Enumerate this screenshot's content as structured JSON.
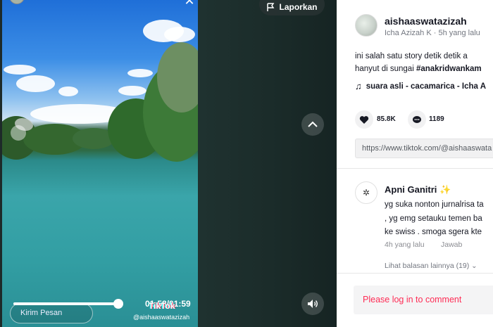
{
  "player": {
    "report_label": "Laporkan",
    "time_text": "01:58/01:59",
    "progress_fraction": 0.99,
    "send_message_placeholder": "Kirim Pesan",
    "watermark_logo": "TikTok",
    "watermark_user": "@aishaaswatazizah"
  },
  "post": {
    "username": "aishaaswatazizah",
    "display_name": "Icha Azizah K",
    "time_ago": "5h yang lalu",
    "caption_line1": "ini salah satu story detik detik a",
    "caption_line2_pre": "hanyut di sungai ",
    "caption_hashtag": "#anakridwankam",
    "music": "suara asli - cacamarica - Icha A",
    "likes": "85.8K",
    "comments": "1189",
    "link": "https://www.tiktok.com/@aishaaswata"
  },
  "comment": {
    "author": "Apni Ganitri",
    "author_emoji": "✨",
    "line1": "yg suka nonton jurnalrisa ta",
    "line2": ", yg emg setauku temen ba",
    "line3": "ke swiss . smoga sgera kte",
    "time": "4h yang lalu",
    "reply_label": "Jawab",
    "more_replies": "Lihat balasan lainnya (19)"
  },
  "login_prompt": "Please log in to comment",
  "colors": {
    "accent": "#fe2c55",
    "text": "#161823",
    "muted": "#737780"
  }
}
